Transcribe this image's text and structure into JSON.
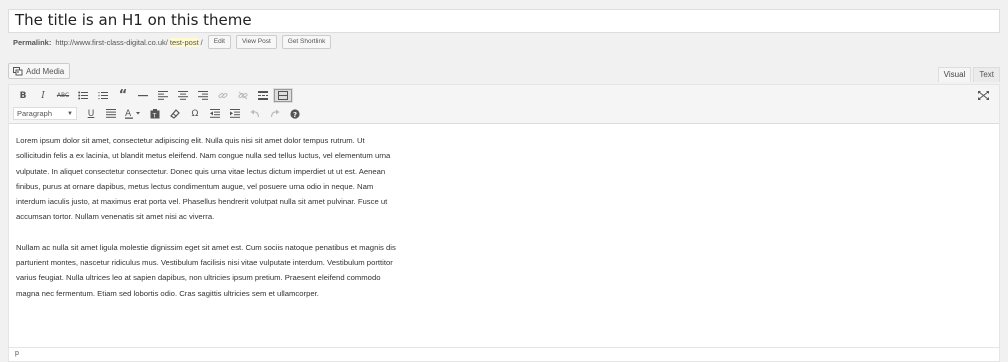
{
  "post": {
    "title": "The title is an H1 on this theme",
    "permalink_label": "Permalink:",
    "permalink_base": "http://www.first-class-digital.co.uk/",
    "permalink_slug": "test-post",
    "permalink_trail": "/",
    "edit_label": "Edit",
    "view_label": "View Post",
    "shortlink_label": "Get Shortlink"
  },
  "media": {
    "add_media_label": "Add Media",
    "icon": "add-media-icon"
  },
  "tabs": [
    {
      "label": "Visual",
      "active": true
    },
    {
      "label": "Text",
      "active": false
    }
  ],
  "toolbar": {
    "row1": [
      "bold",
      "italic",
      "strikethrough",
      "bulleted-list",
      "numbered-list",
      "blockquote",
      "horizontal-line",
      "align-left",
      "align-center",
      "align-right",
      "insert-link",
      "remove-link",
      "read-more",
      "toolbar-toggle"
    ],
    "row2": [
      "underline",
      "justify",
      "text-color",
      "paste-as-text",
      "clear-formatting",
      "special-character",
      "decrease-indent",
      "increase-indent",
      "undo",
      "redo",
      "help"
    ],
    "format_value": "Paragraph",
    "expand_icon": "distraction-free-icon"
  },
  "content": {
    "paragraphs": [
      "Lorem ipsum dolor sit amet, consectetur adipiscing elit. Nulla quis nisi sit amet dolor tempus rutrum. Ut sollicitudin felis a ex lacinia, ut blandit metus eleifend. Nam congue nulla sed tellus luctus, vel elementum urna vulputate. In aliquet consectetur consectetur. Donec quis urna vitae lectus dictum imperdiet ut ut est. Aenean finibus, purus at ornare dapibus, metus lectus condimentum augue, vel posuere urna odio in neque. Nam interdum iaculis justo, at maximus erat porta vel. Phasellus hendrerit volutpat nulla sit amet pulvinar. Fusce ut accumsan tortor. Nullam venenatis sit amet nisi ac viverra.",
      "Nullam ac nulla sit amet ligula molestie dignissim eget sit amet est. Cum sociis natoque penatibus et magnis dis parturient montes, nascetur ridiculus mus. Vestibulum facilisis nisi vitae vulputate interdum. Vestibulum porttitor varius feugiat. Nulla ultrices leo at sapien dapibus, non ultricies ipsum pretium. Praesent eleifend commodo magna nec fermentum. Etiam sed lobortis odio. Cras sagittis ultricies sem et ullamcorper."
    ]
  },
  "status_path": "p"
}
